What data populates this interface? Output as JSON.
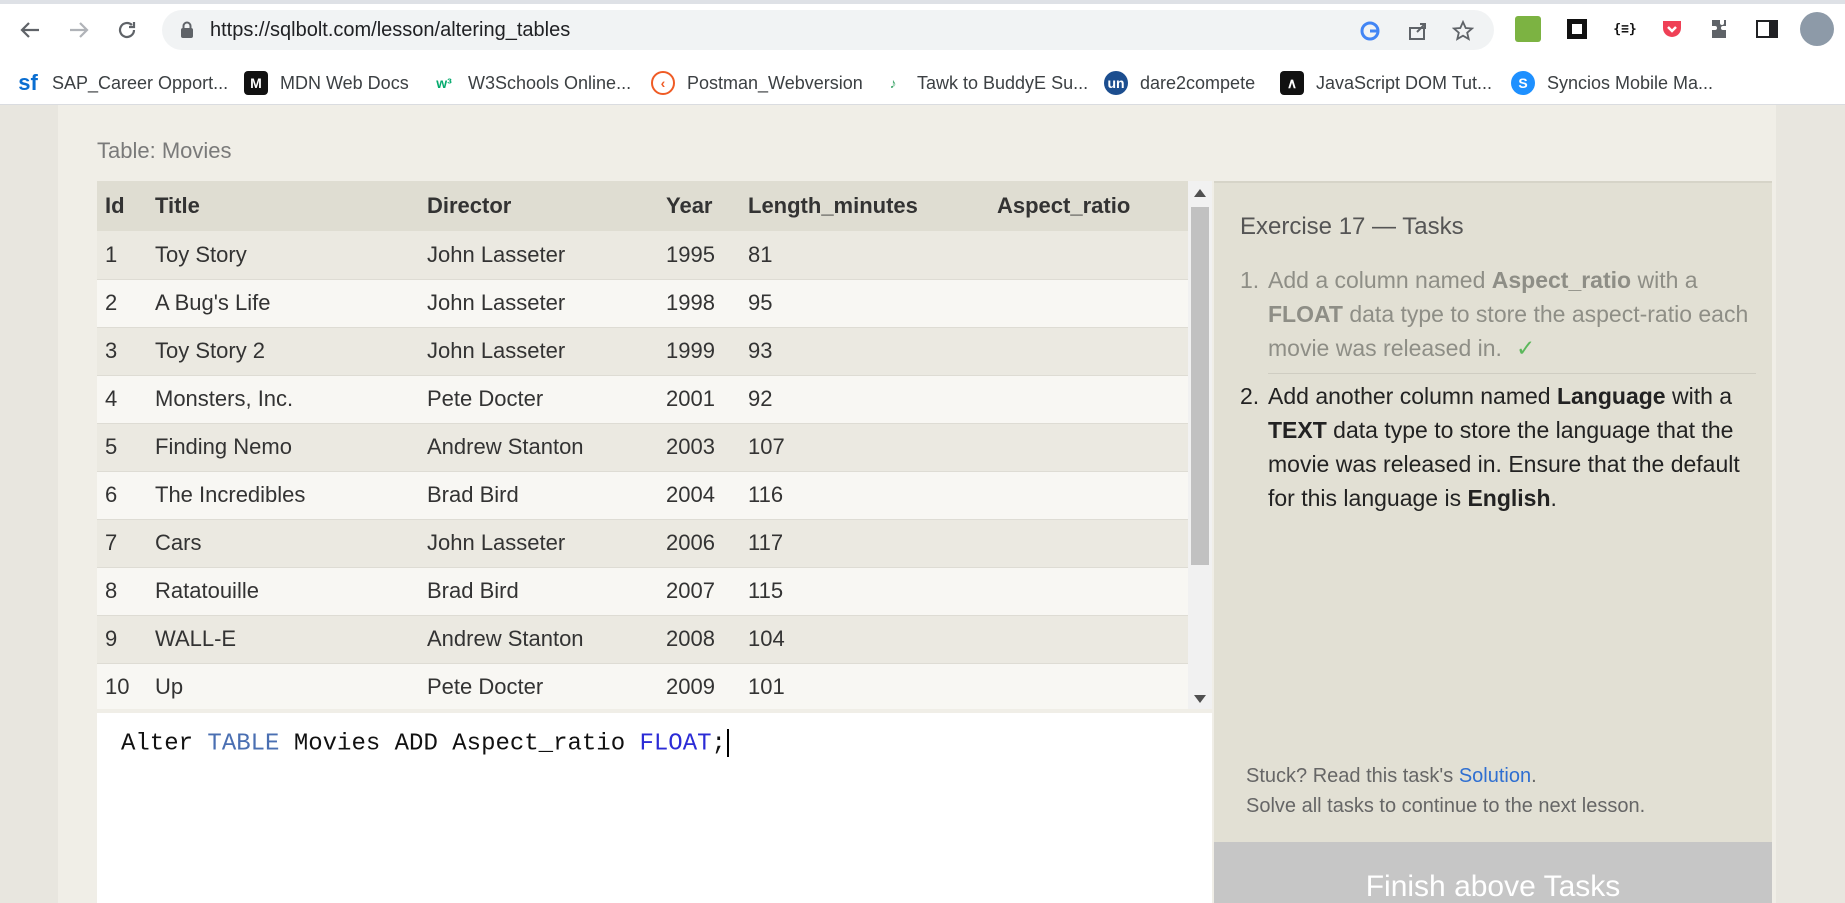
{
  "browser": {
    "url": "https://sqlbolt.com/lesson/altering_tables",
    "bookmarks": [
      {
        "label": "SAP_Career Opport...",
        "icon": "sf"
      },
      {
        "label": "MDN Web Docs",
        "icon": "M"
      },
      {
        "label": "W3Schools Online...",
        "icon": "w3"
      },
      {
        "label": "Postman_Webversion",
        "icon": "postman"
      },
      {
        "label": "Tawk to BuddyE Su...",
        "icon": "tawk"
      },
      {
        "label": "dare2compete",
        "icon": "un"
      },
      {
        "label": "JavaScript DOM Tut...",
        "icon": "js"
      },
      {
        "label": "Syncios Mobile Ma...",
        "icon": "syncios"
      }
    ]
  },
  "table": {
    "caption": "Table: Movies",
    "columns": [
      "Id",
      "Title",
      "Director",
      "Year",
      "Length_minutes",
      "Aspect_ratio"
    ],
    "rows": [
      [
        "1",
        "Toy Story",
        "John Lasseter",
        "1995",
        "81",
        ""
      ],
      [
        "2",
        "A Bug's Life",
        "John Lasseter",
        "1998",
        "95",
        ""
      ],
      [
        "3",
        "Toy Story 2",
        "John Lasseter",
        "1999",
        "93",
        ""
      ],
      [
        "4",
        "Monsters, Inc.",
        "Pete Docter",
        "2001",
        "92",
        ""
      ],
      [
        "5",
        "Finding Nemo",
        "Andrew Stanton",
        "2003",
        "107",
        ""
      ],
      [
        "6",
        "The Incredibles",
        "Brad Bird",
        "2004",
        "116",
        ""
      ],
      [
        "7",
        "Cars",
        "John Lasseter",
        "2006",
        "117",
        ""
      ],
      [
        "8",
        "Ratatouille",
        "Brad Bird",
        "2007",
        "115",
        ""
      ],
      [
        "9",
        "WALL-E",
        "Andrew Stanton",
        "2008",
        "104",
        ""
      ],
      [
        "10",
        "Up",
        "Pete Docter",
        "2009",
        "101",
        ""
      ]
    ]
  },
  "editor": {
    "code_parts": {
      "p1": "Alter ",
      "kw1": "TABLE",
      "p2": " Movies ADD Aspect_ratio ",
      "kw2": "FLOAT",
      "p3": ";"
    }
  },
  "tasks": {
    "title": "Exercise 17 — Tasks",
    "items": [
      {
        "num": "1.",
        "t1": "Add a column named ",
        "b1": "Aspect_ratio",
        "t2": " with a ",
        "b2": "FLOAT",
        "t3": " data type to store the aspect-ratio each movie was released in.",
        "check": "✓"
      },
      {
        "num": "2.",
        "t1": "Add another column named ",
        "b1": "Language",
        "t2": " with a ",
        "b2": "TEXT",
        "t3": " data type to store the language that the movie was released in. Ensure that the default for this language is ",
        "b3": "English",
        "t4": "."
      }
    ],
    "stuck_text": "Stuck? Read this task's ",
    "solution_link": "Solution",
    "stuck_end": ".",
    "continue_text": "Solve all tasks to continue to the next lesson.",
    "finish_button": "Finish above Tasks"
  }
}
